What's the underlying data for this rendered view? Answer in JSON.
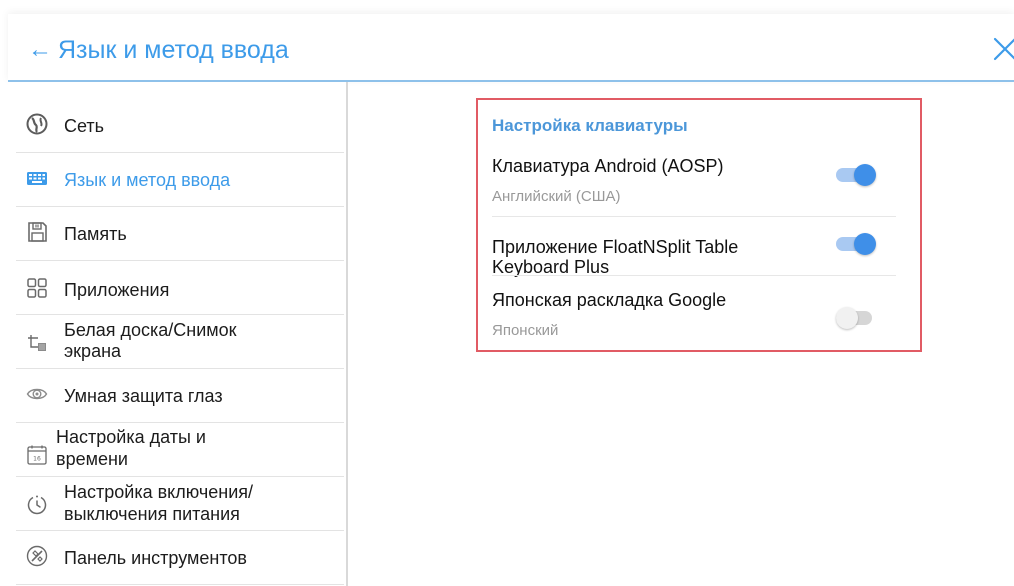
{
  "header": {
    "back_symbol": "←",
    "title": "Язык и метод ввода",
    "close_icon": "close-icon",
    "accent": "#3d9be9"
  },
  "sidebar": {
    "items": [
      {
        "label": "Сеть",
        "icon": "globe-icon"
      },
      {
        "label": "Язык и метод ввода",
        "icon": "keyboard-icon",
        "active": true
      },
      {
        "label": "Память",
        "icon": "storage-icon"
      },
      {
        "label": "Приложения",
        "icon": "apps-icon"
      },
      {
        "label": "Белая доска/Снимок экрана",
        "label_line1": "Белая доска/Снимок",
        "label_line2": "экрана",
        "icon": "whiteboard-screenshot-icon"
      },
      {
        "label": "Умная защита глаз",
        "icon": "eye-icon"
      },
      {
        "label": "Настройка даты и времени",
        "label_line1": "Настройка даты и",
        "label_line2": "времени",
        "icon": "calendar-icon"
      },
      {
        "label": "Настройка включения/выключения питания",
        "label_line1": "Настройка включения/",
        "label_line2": "выключения питания",
        "icon": "power-timer-icon"
      },
      {
        "label": "Панель инструментов",
        "icon": "toolbar-icon"
      }
    ]
  },
  "keyboard_settings": {
    "title": "Настройка клавиатуры",
    "items": [
      {
        "title": "Клавиатура Android (AOSP)",
        "subtitle": "Английский (США)",
        "enabled": true
      },
      {
        "title": "Приложение FloatNSplit Table Keyboard Plus",
        "title_line1": "Приложение FloatNSplit Table",
        "title_line2": "Keyboard Plus",
        "enabled": true
      },
      {
        "title": "Японская раскладка Google",
        "subtitle": "Японский",
        "enabled": false
      }
    ]
  },
  "colors": {
    "accent": "#3d9be9",
    "highlight_border": "#e15b64",
    "toggle_on": "#3f8fe8"
  }
}
